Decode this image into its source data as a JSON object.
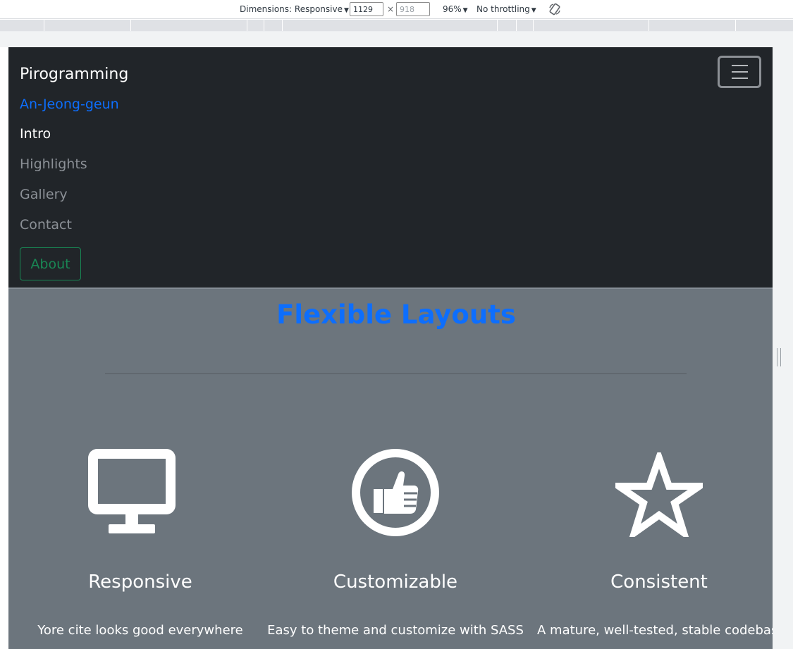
{
  "devtools": {
    "dimensions_label": "Dimensions: Responsive",
    "width": "1129",
    "height": "918",
    "zoom": "96%",
    "throttling": "No throttling",
    "icons": {
      "rotate": "rotate-icon"
    }
  },
  "navbar": {
    "brand": "Pirogramming",
    "subtitle": "An-Jeong-geun",
    "links": [
      "Intro",
      "Highlights",
      "Gallery",
      "Contact"
    ],
    "active_index": 0,
    "about_button": "About",
    "toggler_icon": "hamburger-icon"
  },
  "section": {
    "title": "Flexible Layouts",
    "features": [
      {
        "icon": "monitor-icon",
        "title": "Responsive",
        "text": "Yore cite looks good everywhere"
      },
      {
        "icon": "thumbs-up-icon",
        "title": "Customizable",
        "text": "Easy to theme and customize with SASS"
      },
      {
        "icon": "star-icon",
        "title": "Consistent",
        "text": "A mature, well-tested, stable codebase"
      }
    ]
  },
  "colors": {
    "navbar_bg": "#212529",
    "section_bg": "#6c757d",
    "primary": "#0d6efd",
    "success": "#198754",
    "white": "#ffffff"
  }
}
